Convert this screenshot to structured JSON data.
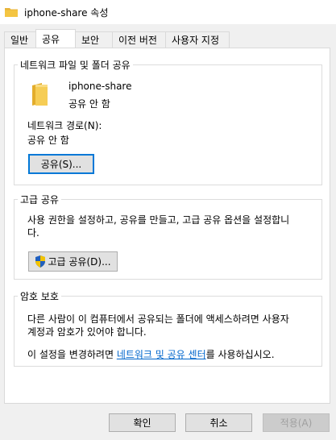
{
  "window": {
    "title": "iphone-share 속성"
  },
  "tabs": [
    {
      "label": "일반"
    },
    {
      "label": "공유"
    },
    {
      "label": "보안"
    },
    {
      "label": "이전 버전"
    },
    {
      "label": "사용자 지정"
    }
  ],
  "active_tab": "공유",
  "network_sharing": {
    "legend": "네트워크 파일 및 폴더 공유",
    "folder_name": "iphone-share",
    "status": "공유 안 함",
    "path_label": "네트워크 경로(N):",
    "path_value": "공유 안 함",
    "share_button": "공유(S)..."
  },
  "advanced_sharing": {
    "legend": "고급 공유",
    "description_line1": "사용 권한을 설정하고, 공유를 만들고, 고급 공유 옵션을 설정합니",
    "description_line2": "다.",
    "button": "고급 공유(D)..."
  },
  "password_protection": {
    "legend": "암호 보호",
    "line1": "다른 사람이 이 컴퓨터에서 공유되는 폴더에 액세스하려면 사용자",
    "line2": "계정과 암호가 있어야 합니다.",
    "line3_prefix": "이 설정을 변경하려면 ",
    "line3_link": "네트워크 및 공유 센터",
    "line3_suffix": "를 사용하십시오."
  },
  "footer": {
    "ok": "확인",
    "cancel": "취소",
    "apply": "적용(A)"
  },
  "colors": {
    "folder": "#f4c542",
    "shield_blue": "#1f5fbf",
    "shield_yellow": "#f2c200",
    "link": "#0066cc"
  }
}
